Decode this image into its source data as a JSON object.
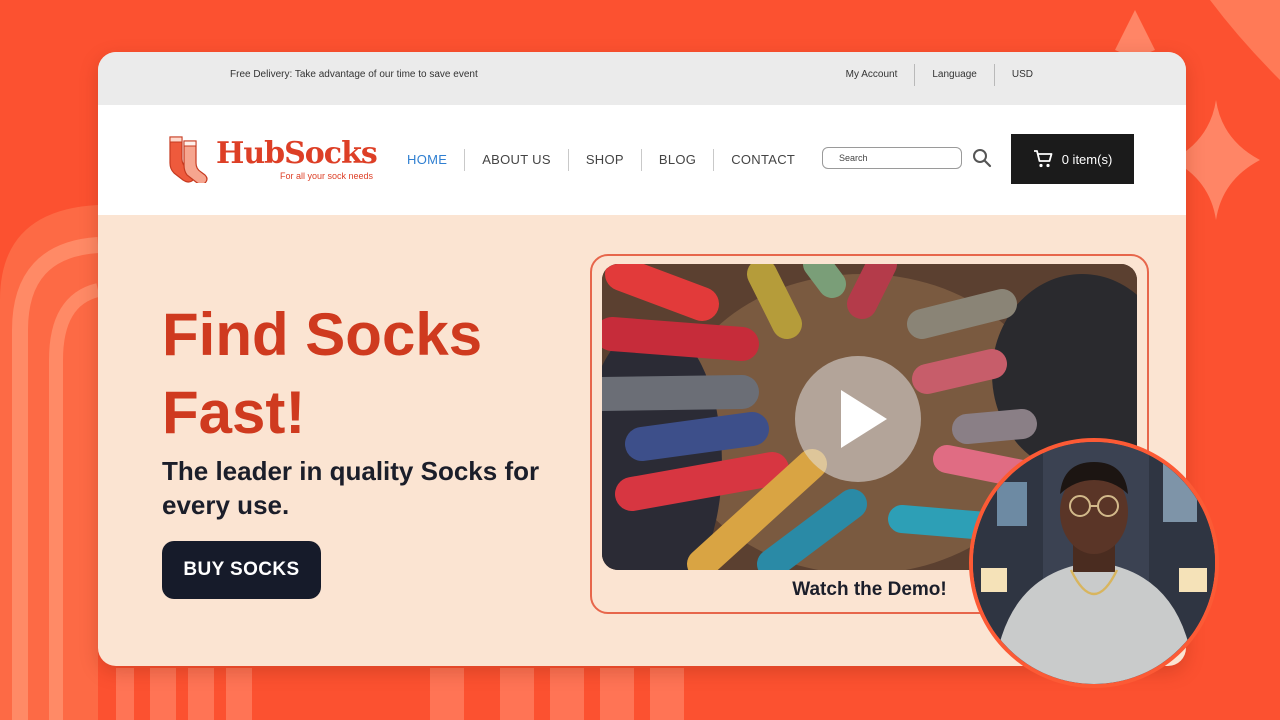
{
  "topbar": {
    "promo": "Free Delivery: Take advantage of our time to save event",
    "links": [
      "My Account",
      "Language",
      "USD"
    ]
  },
  "brand": {
    "name": "HubSocks",
    "tagline": "For all your sock needs",
    "icon": "socks-icon"
  },
  "nav": {
    "items": [
      "HOME",
      "ABOUT US",
      "SHOP",
      "BLOG",
      "CONTACT"
    ],
    "active": "HOME"
  },
  "search": {
    "placeholder": "Search",
    "icon": "search-icon"
  },
  "cart": {
    "label": "0 item(s)",
    "icon": "cart-icon"
  },
  "hero": {
    "title": "Find Socks Fast!",
    "subtitle": "The leader in quality Socks for every use.",
    "cta": "BUY SOCKS"
  },
  "demo": {
    "caption": "Watch the Demo!",
    "play_icon": "play-icon"
  },
  "colors": {
    "background": "#fc5130",
    "brand": "#dd3f26",
    "hero_title": "#cf3a1f",
    "nav_active": "#2f7fd1",
    "cart_bg": "#1b1b1b",
    "cta_bg": "#161b2a",
    "hero_bg": "#fbe4d2"
  }
}
